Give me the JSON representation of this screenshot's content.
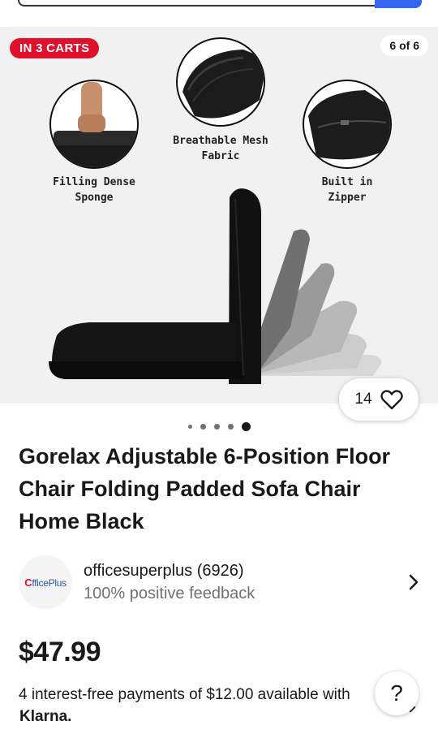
{
  "header": {
    "search_bar": ""
  },
  "gallery": {
    "badge": "IN 3 CARTS",
    "counter": "6 of 6",
    "callouts": {
      "filling_line1": "Filling Dense",
      "filling_line2": "Sponge",
      "mesh_line1": "Breathable Mesh",
      "mesh_line2": "Fabric",
      "zipper": "Built in Zipper"
    },
    "watch_count": "14",
    "dots": 5,
    "active_dot": 5
  },
  "product": {
    "title": "Gorelax Adjustable 6-Position Floor Chair Folding Padded Sofa Chair Home Black"
  },
  "seller": {
    "logo_text": "fficePlus",
    "logo_letter": "C",
    "name": "officesuperplus (6926)",
    "feedback": "100% positive feedback"
  },
  "pricing": {
    "price": "$47.99",
    "installment": "4 interest-free payments of $12.00 available with",
    "provider": "Klarna."
  },
  "help": {
    "label": "?"
  },
  "colors": {
    "badge": "#e0102a",
    "accent": "#3665f3",
    "text": "#191919",
    "muted": "#707070"
  }
}
